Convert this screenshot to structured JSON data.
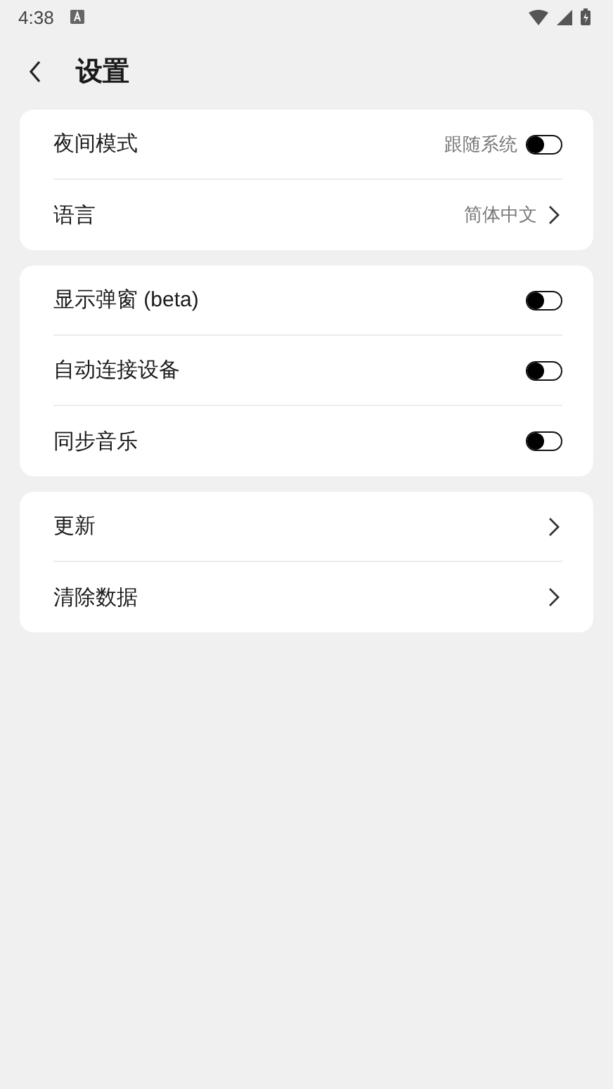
{
  "status_bar": {
    "time": "4:38"
  },
  "header": {
    "title": "设置"
  },
  "groups": [
    {
      "items": [
        {
          "kind": "toggle",
          "label": "夜间模式",
          "value": "跟随系统",
          "on": false
        },
        {
          "kind": "link",
          "label": "语言",
          "value": "简体中文"
        }
      ]
    },
    {
      "items": [
        {
          "kind": "toggle",
          "label": "显示弹窗 (beta)",
          "on": false
        },
        {
          "kind": "toggle",
          "label": "自动连接设备",
          "on": false
        },
        {
          "kind": "toggle",
          "label": "同步音乐",
          "on": false
        }
      ]
    },
    {
      "items": [
        {
          "kind": "link",
          "label": "更新"
        },
        {
          "kind": "link",
          "label": "清除数据"
        }
      ]
    }
  ]
}
